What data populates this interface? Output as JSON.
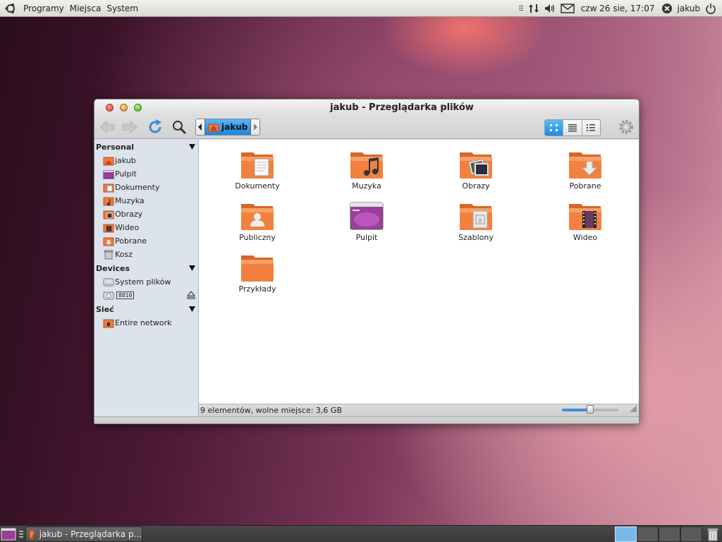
{
  "top_panel": {
    "menus": [
      "Programy",
      "Miejsca",
      "System"
    ],
    "clock": "czw 26 sie, 17:07",
    "user": "jakub"
  },
  "window": {
    "title": "jakub - Przeglądarka plików",
    "path_crumb": "jakub"
  },
  "sidebar": {
    "personal_header": "Personal",
    "personal": [
      "jakub",
      "Pulpit",
      "Dokumenty",
      "Muzyka",
      "Obrazy",
      "Wideo",
      "Pobrane",
      "Kosz"
    ],
    "devices_header": "Devices",
    "devices": [
      "System plików",
      "8810"
    ],
    "network_header": "Sieć",
    "network": [
      "Entire network"
    ]
  },
  "files": [
    {
      "label": "Dokumenty",
      "icon": "folder-documents-icon"
    },
    {
      "label": "Muzyka",
      "icon": "folder-music-icon"
    },
    {
      "label": "Obrazy",
      "icon": "folder-pictures-icon"
    },
    {
      "label": "Pobrane",
      "icon": "folder-download-icon"
    },
    {
      "label": "Publiczny",
      "icon": "folder-public-icon"
    },
    {
      "label": "Pulpit",
      "icon": "desktop-folder-icon"
    },
    {
      "label": "Szablony",
      "icon": "folder-templates-icon"
    },
    {
      "label": "Wideo",
      "icon": "folder-videos-icon"
    },
    {
      "label": "Przykłady",
      "icon": "folder-icon"
    }
  ],
  "statusbar": {
    "text": "9 elementów, wolne miejsce: 3,6 GB",
    "zoom_fraction": 0.5
  },
  "taskbar": {
    "task_label": "jakub - Przeglądarka p...",
    "workspaces": 4,
    "active_workspace": 1
  },
  "colors": {
    "folder_orange": "#f07a3a",
    "selection_blue": "#2b8de4"
  }
}
